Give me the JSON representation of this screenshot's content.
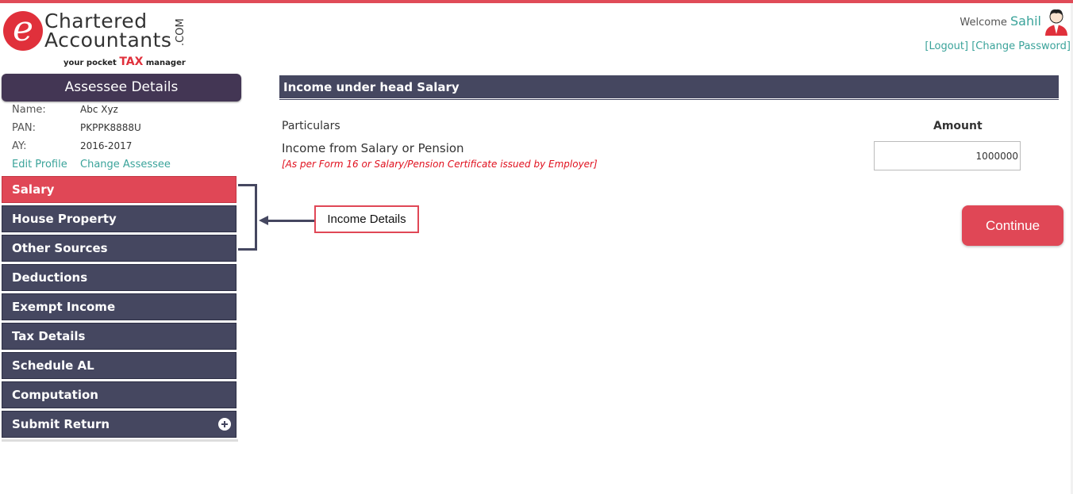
{
  "header": {
    "logo_letter": "e",
    "logo_line1": "Chartered",
    "logo_line2": "Accountants",
    "logo_suffix": ".COM",
    "logo_tagline_pre": "your pocket",
    "logo_tagline_tax": "TAX",
    "logo_tagline_post": "manager",
    "welcome_label": "Welcome",
    "user_name": "Sahil",
    "logout_link": "[Logout]",
    "change_password_link": "[Change Password]",
    "avatar_icon": "user-avatar-icon"
  },
  "sidebar": {
    "title": "Assessee Details",
    "fields": [
      {
        "label": "Name:",
        "value": "Abc Xyz"
      },
      {
        "label": "PAN:",
        "value": "PKPPK8888U"
      },
      {
        "label": "AY:",
        "value": "2016-2017"
      }
    ],
    "edit_profile": "Edit Profile",
    "change_assessee": "Change Assessee",
    "menu": [
      {
        "label": "Salary",
        "active": true
      },
      {
        "label": "House Property"
      },
      {
        "label": "Other Sources"
      },
      {
        "label": "Deductions"
      },
      {
        "label": "Exempt Income"
      },
      {
        "label": "Tax Details"
      },
      {
        "label": "Schedule AL"
      },
      {
        "label": "Computation"
      },
      {
        "label": "Submit Return",
        "icon": "plus-circle-icon"
      }
    ]
  },
  "annotation": {
    "callout": "Income Details"
  },
  "main": {
    "section_title": "Income under head Salary",
    "col_particulars": "Particulars",
    "col_amount": "Amount",
    "row_label": "Income from Salary or Pension",
    "row_note": "[As per Form 16 or Salary/Pension Certificate issued by Employer]",
    "amount_value": "1000000",
    "continue_label": "Continue"
  },
  "colors": {
    "accent_red": "#e04756",
    "nav_dark": "#454760",
    "link_teal": "#3aa39a"
  }
}
